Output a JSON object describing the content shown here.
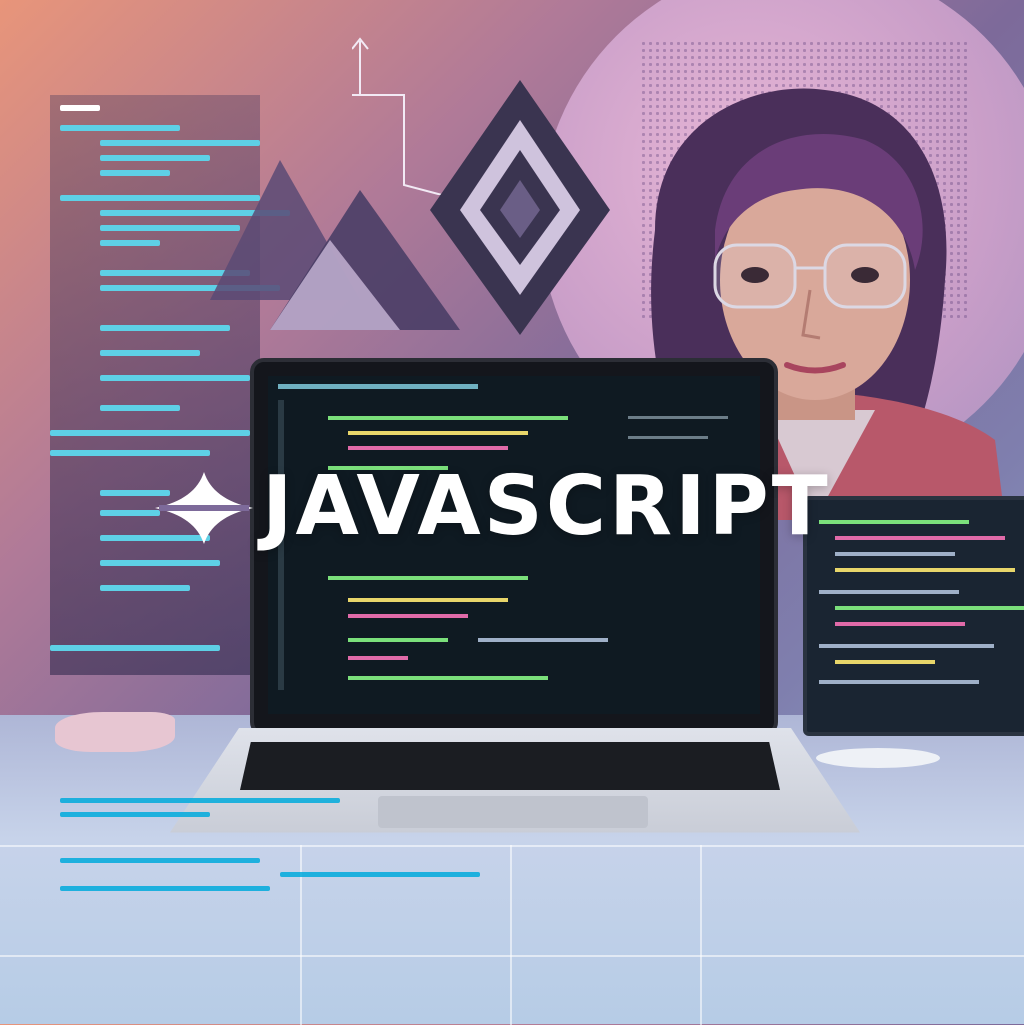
{
  "headline": {
    "text": "JAVASCRIPT"
  },
  "colors": {
    "background_warm": "#e8957a",
    "background_cool": "#9bb3d2",
    "code_cyan": "#00aadc",
    "code_green": "#7be07b",
    "code_pink": "#e06aa8",
    "code_yellow": "#e8d66a",
    "headline": "#ffffff"
  },
  "scene": {
    "objects": [
      "laptop-icon",
      "monitor-icon",
      "mouse-icon",
      "person-with-glasses",
      "abstract-logo-shape",
      "code-panel"
    ]
  }
}
